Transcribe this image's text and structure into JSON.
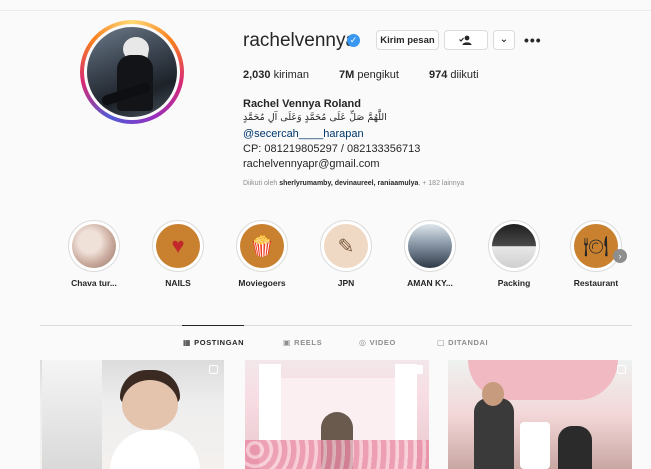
{
  "profile": {
    "username": "rachelvennya",
    "verified_mark": "✓",
    "message_button": "Kirim pesan",
    "follow_icon": "person-check-icon",
    "dropdown_glyph": "⌄",
    "more_glyph": "•••",
    "stats": {
      "posts_count": "2,030",
      "posts_label": "kiriman",
      "followers_count": "7M",
      "followers_label": "pengikut",
      "following_count": "974",
      "following_label": "diikuti"
    },
    "full_name": "Rachel Vennya Roland",
    "bio_arabic": "اللَّهُمَّ صَلِّ عَلَى مُحَمَّدٍ وَعَلَى آلِ مُحَمَّدٍ",
    "bio_link": "@secercah____harapan",
    "bio_cp": "CP: 081219805297 / 082133356713",
    "bio_email": "rachelvennyapr@gmail.com",
    "followed_by_prefix": "Diikuti oleh",
    "followed_by_names": "sherlyrumamby, devinaureel, raniaamulya",
    "followed_by_suffix": ", + 182 lainnya"
  },
  "highlights": [
    {
      "label": "Chava tur...",
      "icon": "photo-thumbnail",
      "glyph": "",
      "bg": "#c9a99b"
    },
    {
      "label": "NAILS",
      "icon": "heart-hand-icon",
      "glyph": "♥",
      "bg": "#c9812f"
    },
    {
      "label": "Moviegoers",
      "icon": "popcorn-icon",
      "glyph": "🍿",
      "bg": "#c9812f"
    },
    {
      "label": "JPN",
      "icon": "sketch-icon",
      "glyph": "✎",
      "bg": "#efd9c4"
    },
    {
      "label": "AMAN KY...",
      "icon": "photo-thumbnail",
      "glyph": "",
      "bg": "#2f3a48"
    },
    {
      "label": "Packing",
      "icon": "photo-thumbnail",
      "glyph": "",
      "bg": "#3b3b3b"
    },
    {
      "label": "Restaurant",
      "icon": "food-cloche-icon",
      "glyph": "🍽",
      "bg": "#c9812f"
    }
  ],
  "highlights_next_glyph": "›",
  "tabs": [
    {
      "label": "POSTINGAN",
      "icon": "grid-icon",
      "glyph": "▦",
      "active": true
    },
    {
      "label": "REELS",
      "icon": "reels-icon",
      "glyph": "▣",
      "active": false
    },
    {
      "label": "VIDEO",
      "icon": "video-icon",
      "glyph": "◎",
      "active": false
    },
    {
      "label": "DITANDAI",
      "icon": "tagged-icon",
      "glyph": "▢",
      "active": false
    }
  ],
  "colors": {
    "verified": "#3897f0",
    "link": "#00376b",
    "muted": "#8e8e8e",
    "text": "#262626"
  }
}
